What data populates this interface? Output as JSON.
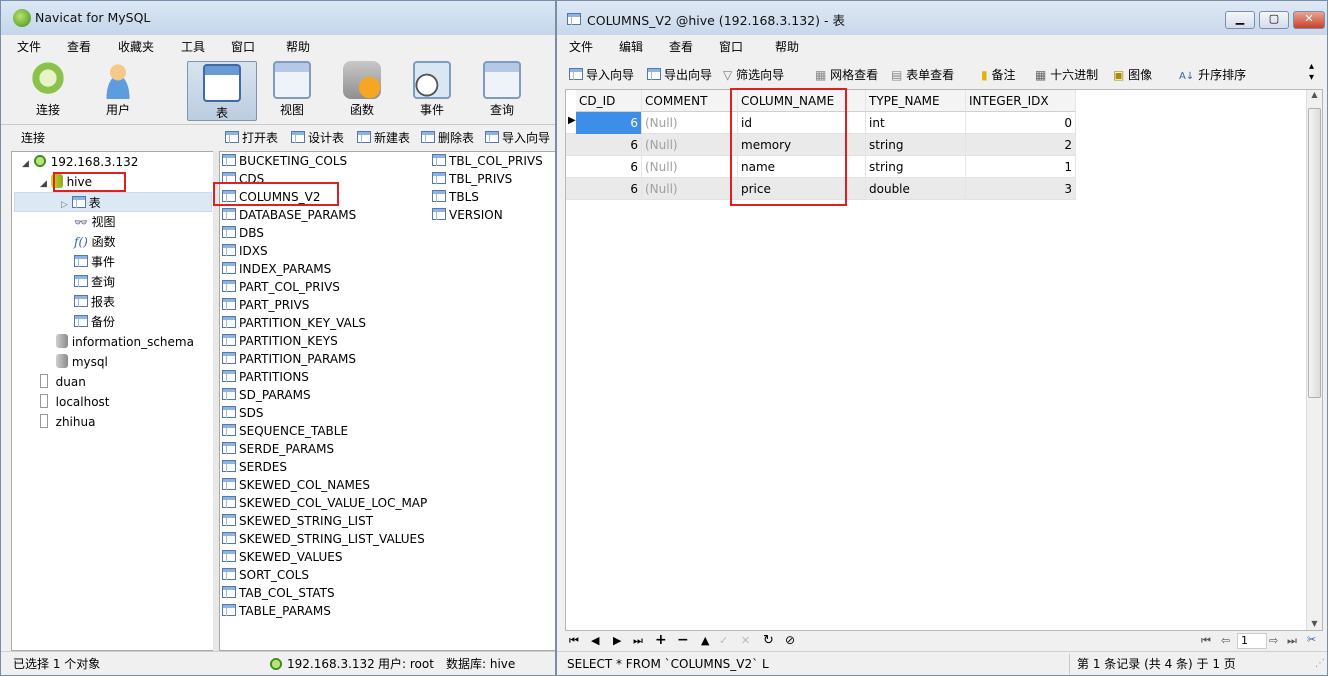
{
  "left_window": {
    "title": "Navicat for MySQL",
    "menu": [
      "文件",
      "查看",
      "收藏夹",
      "工具",
      "窗口",
      "帮助"
    ],
    "toolbar": [
      "连接",
      "用户",
      "表",
      "视图",
      "函数",
      "事件",
      "查询"
    ],
    "subtoolbar_label": "连接",
    "object_actions": [
      "打开表",
      "设计表",
      "新建表",
      "删除表",
      "导入向导"
    ],
    "tree": {
      "server": "192.168.3.132",
      "db": "hive",
      "children": [
        "表",
        "视图",
        "函数",
        "事件",
        "查询",
        "报表",
        "备份"
      ],
      "other_dbs": [
        "information_schema",
        "mysql"
      ],
      "other_connections": [
        "duan",
        "localhost",
        "zhihua"
      ]
    },
    "tables_col1": [
      "BUCKETING_COLS",
      "CDS",
      "COLUMNS_V2",
      "DATABASE_PARAMS",
      "DBS",
      "IDXS",
      "INDEX_PARAMS",
      "PART_COL_PRIVS",
      "PART_PRIVS",
      "PARTITION_KEY_VALS",
      "PARTITION_KEYS",
      "PARTITION_PARAMS",
      "PARTITIONS",
      "SD_PARAMS",
      "SDS",
      "SEQUENCE_TABLE",
      "SERDE_PARAMS",
      "SERDES",
      "SKEWED_COL_NAMES",
      "SKEWED_COL_VALUE_LOC_MAP",
      "SKEWED_STRING_LIST",
      "SKEWED_STRING_LIST_VALUES",
      "SKEWED_VALUES",
      "SORT_COLS",
      "TAB_COL_STATS",
      "TABLE_PARAMS"
    ],
    "tables_col2": [
      "TBL_COL_PRIVS",
      "TBL_PRIVS",
      "TBLS",
      "VERSION"
    ],
    "status_selected": "已选择 1 个对象",
    "status_server": "192.168.3.132",
    "status_user": "用户: root",
    "status_db": "数据库: hive"
  },
  "right_window": {
    "title": "COLUMNS_V2 @hive (192.168.3.132) - 表",
    "menu": [
      "文件",
      "编辑",
      "查看",
      "窗口",
      "帮助"
    ],
    "toolbar": [
      "导入向导",
      "导出向导",
      "筛选向导",
      "网格查看",
      "表单查看",
      "备注",
      "十六进制",
      "图像",
      "升序排序"
    ],
    "columns": [
      "CD_ID",
      "COMMENT",
      "COLUMN_NAME",
      "TYPE_NAME",
      "INTEGER_IDX"
    ],
    "rows": [
      [
        "6",
        "(Null)",
        "id",
        "int",
        "0"
      ],
      [
        "6",
        "(Null)",
        "memory",
        "string",
        "2"
      ],
      [
        "6",
        "(Null)",
        "name",
        "string",
        "1"
      ],
      [
        "6",
        "(Null)",
        "price",
        "double",
        "3"
      ]
    ],
    "page_number": "1",
    "sql": "SELECT * FROM `COLUMNS_V2` L",
    "record_status": "第 1 条记录 (共 4 条) 于 1 页"
  },
  "colors": {
    "highlight": "#e02020",
    "selected_cell": "#3d8ee8",
    "null_text": "#a0a0a0"
  }
}
